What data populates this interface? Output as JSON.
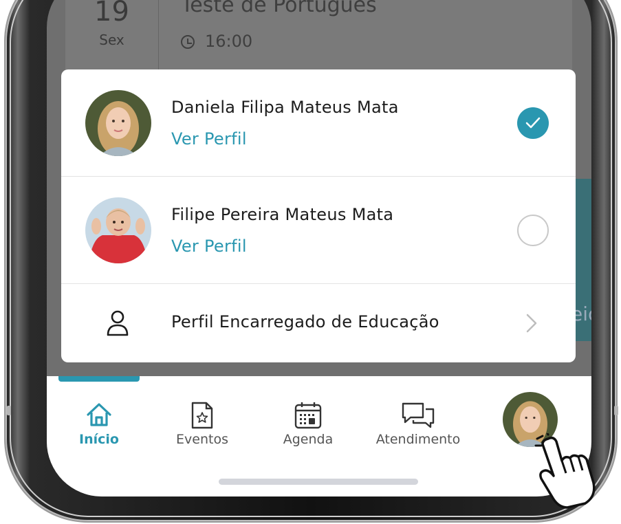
{
  "background_event": {
    "day_number": "19",
    "day_name": "Sex",
    "title": "Teste de Português",
    "time": "16:00",
    "teal_text": "eio"
  },
  "profile_popup": {
    "students": [
      {
        "name": "Daniela Filipa Mateus Mata",
        "link": "Ver Perfil",
        "selected": true,
        "avatar": "girl-photo"
      },
      {
        "name": "Filipe Pereira Mateus Mata",
        "link": "Ver Perfil",
        "selected": false,
        "avatar": "boy-photo"
      }
    ],
    "guardian_label": "Perfil Encarregado de Educação",
    "guardian_icon": "person-outline-icon"
  },
  "bottom_nav": {
    "items": [
      {
        "label": "Início",
        "icon": "home-icon",
        "active": true
      },
      {
        "label": "Eventos",
        "icon": "document-star-icon",
        "active": false
      },
      {
        "label": "Agenda",
        "icon": "calendar-icon",
        "active": false
      },
      {
        "label": "Atendimento",
        "icon": "chat-bubbles-icon",
        "active": false
      }
    ],
    "profile_avatar": "girl-photo"
  },
  "colors": {
    "accent": "#2a97b0",
    "overlay": "#6f6f6f"
  }
}
